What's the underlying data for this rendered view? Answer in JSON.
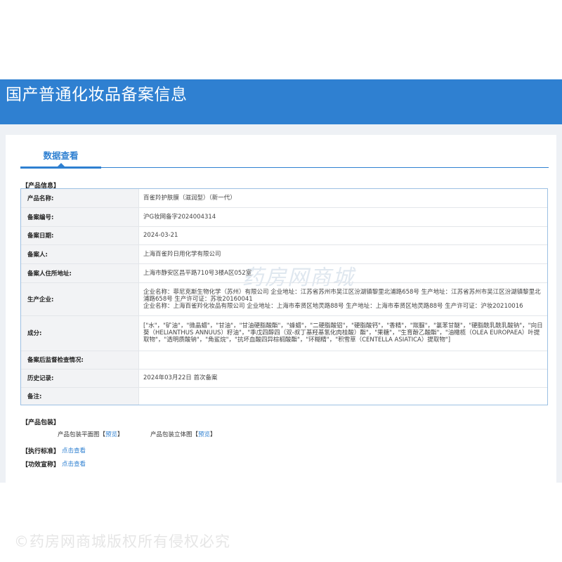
{
  "header": {
    "title": "国产普通化妆品备案信息"
  },
  "tabs": [
    {
      "label": "数据查看"
    }
  ],
  "product_info": {
    "section_label": "【产品信息】",
    "rows": [
      {
        "key": "产品名称:",
        "value": "百雀羚护肤膜（滋润型）（新一代）"
      },
      {
        "key": "备案编号:",
        "value": "沪G妆网备字2024004314"
      },
      {
        "key": "备案日期:",
        "value": "2024-03-21"
      },
      {
        "key": "备案人:",
        "value": "上海百雀羚日用化学有限公司"
      },
      {
        "key": "备案人住所地址:",
        "value": "上海市静安区昌平路710号3楼A区052室"
      },
      {
        "key": "生产企业:",
        "value": "企业名称：菲尼克斯生物化学（苏州）有限公司 企业地址：江苏省苏州市吴江区汾湖镇黎里北浦路658号 生产地址：江苏省苏州市吴江区汾湖镇黎里北浦路658号 生产许可证：苏妆20160041\n企业名称：上海百雀羚化妆品有限公司 企业地址：上海市奉贤区地灵路88号 生产地址：上海市奉贤区地灵路88号 生产许可证：沪妆20210016"
      },
      {
        "key": "成分:",
        "value": "[\"水\"，\"矿油\"，\"微晶蜡\"，\"甘油\"，\"甘油硬脂酸酯\"，\"蜂蜡\"，\"二硬脂酸铝\"，\"硬脂酸钙\"，\"香精\"，\"羰脲\"，\"氯苯甘醚\"，\"硬脂酰乳酰乳酸钠\"，\"向日葵（HELIANTHUS ANNUUS）籽油\"，\"季戊四醇四（双-叔丁基羟基氢化肉桂酸）酯\"，\"果糖\"，\"生育酚乙酸酯\"，\"油橄榄（OLEA EUROPAEA）叶提取物\"，\"透明质酸钠\"，\"角鲨烷\"，\"抗坏血酸四异棕榈酸酯\"，\"环糊精\"，\"积雪草（CENTELLA ASIATICA）提取物\"]"
      },
      {
        "key": "备案后监督检查情况:",
        "value": ""
      },
      {
        "key": "历史记录:",
        "value": "2024年03月22日 首次备案"
      },
      {
        "key": "备注:",
        "value": ""
      }
    ]
  },
  "packaging": {
    "section_label": "【产品包装】",
    "flat_label": "产品包装平面图",
    "solid_label": "产品包装立体图",
    "preview_link": "预览",
    "bracket_open": "【",
    "bracket_close": "】"
  },
  "standard": {
    "section_label": "【执行标准】",
    "link": "点击查看"
  },
  "efficacy": {
    "section_label": "【功效宣称】",
    "link": "点击查看"
  },
  "watermarks": {
    "bottom": "©药房网商城版权所有侵权必究",
    "middle": "药房网商城"
  }
}
